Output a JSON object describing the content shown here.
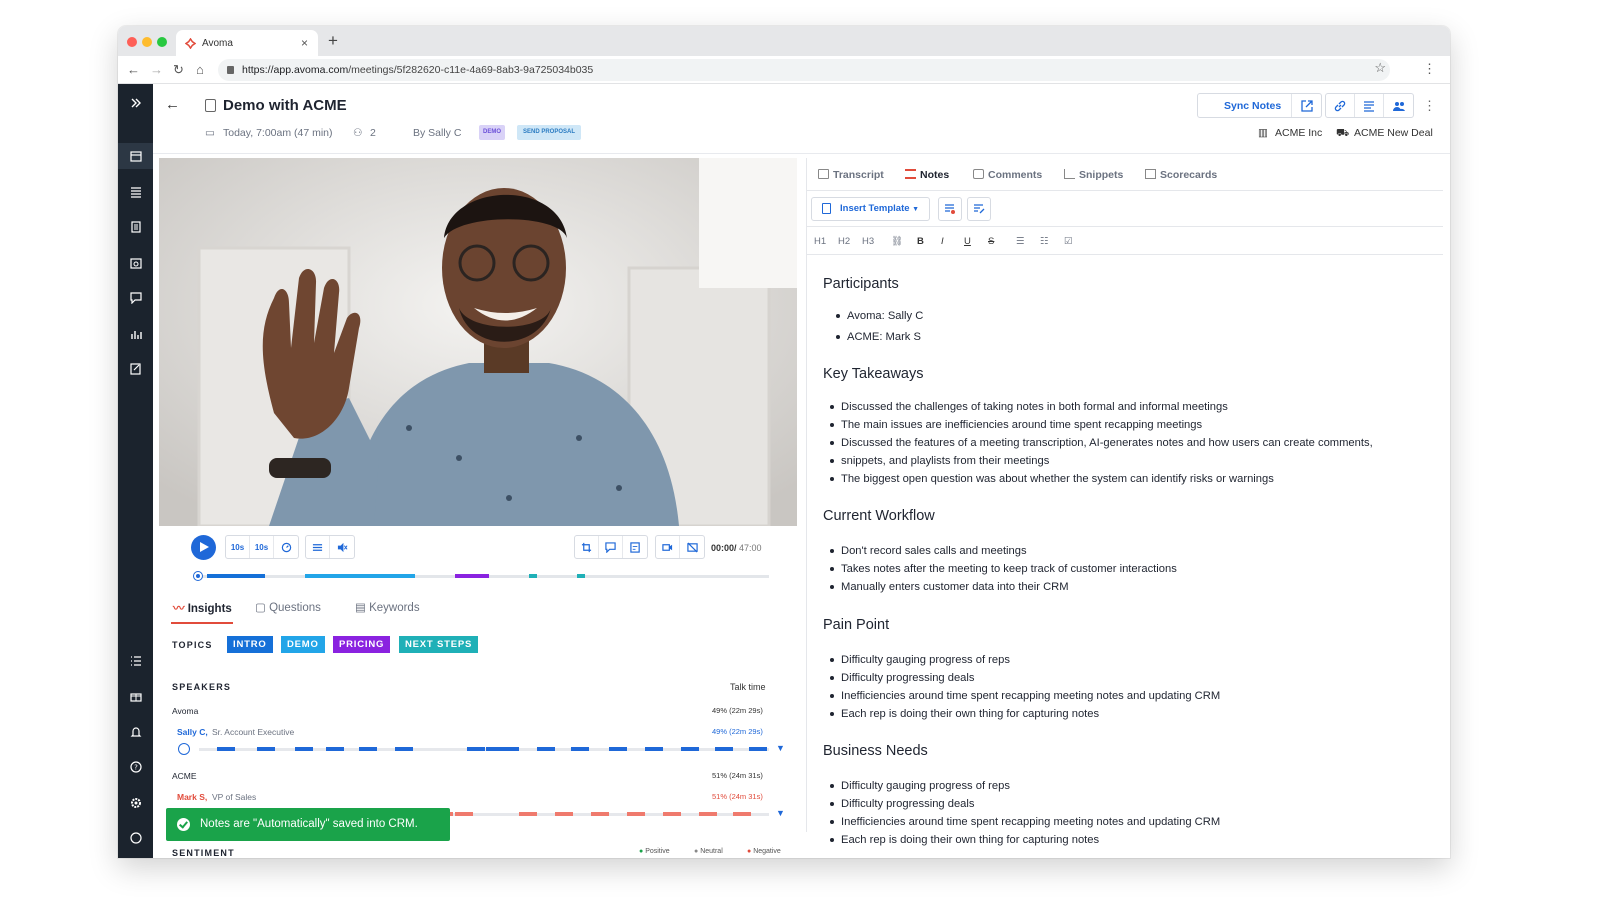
{
  "browser": {
    "tab_title": "Avoma",
    "url_prefix": "https://app.avoma.com",
    "url_path": "/meetings/5f282620-c11e-4a69-8ab3-9a725034b035"
  },
  "meeting": {
    "title": "Demo with ACME",
    "datetime": "Today, 7:00am (47 min)",
    "attendees": "2",
    "by": "By Sally C",
    "tag_demo": "DEMO",
    "tag_send": "SEND PROPOSAL",
    "sync_label": "Sync Notes",
    "crm_account": "ACME Inc",
    "crm_deal": "ACME New Deal"
  },
  "player": {
    "rewind": "10s",
    "forward": "10s",
    "time_current": "00:00/",
    "time_total": " 47:00",
    "progress": 0
  },
  "insights": {
    "tabs": [
      "Insights",
      "Questions",
      "Keywords"
    ],
    "topics_label": "TOPICS",
    "topics": [
      "INTRO",
      "DEMO",
      "PRICING",
      "NEXT STEPS"
    ],
    "speakers_label": "SPEAKERS",
    "talk_time_label": "Talk time",
    "groups": [
      {
        "org": "Avoma",
        "org_stat": "49%  (22m 29s)",
        "speaker": "Sally C,",
        "role": "Sr. Account Executive",
        "stat": "49%  (22m 29s)"
      },
      {
        "org": "ACME",
        "org_stat": "51%  (24m 31s)",
        "speaker": "Mark S,",
        "role": "VP of Sales",
        "stat": "51%  (24m 31s)"
      }
    ],
    "sentiment_label": "SENTIMENT",
    "legend": [
      "Positive",
      "Neutral",
      "Negative"
    ]
  },
  "toast": "Notes are \"Automatically\" saved into CRM.",
  "notes_tabs": [
    "Transcript",
    "Notes",
    "Comments",
    "Snippets",
    "Scorecards"
  ],
  "insert_template": "Insert Template",
  "format_bar": [
    "H1",
    "H2",
    "H3"
  ],
  "notes": {
    "participants_h": "Participants",
    "participants": [
      "Avoma: Sally C",
      "ACME: Mark S"
    ],
    "takeaways_h": "Key Takeaways",
    "takeaways": [
      "Discussed the challenges of taking notes in both formal and informal meetings",
      "The main issues are inefficiencies around time spent recapping meetings",
      "Discussed the features of a meeting transcription, AI-generates notes and how users can create comments,",
      "snippets, and playlists from their meetings",
      "The biggest open question was about whether the system can identify risks or warnings"
    ],
    "workflow_h": "Current Workflow",
    "workflow": [
      "Don't record sales calls and meetings",
      "Takes notes after the meeting to keep track of customer interactions",
      "Manually enters customer data into their CRM"
    ],
    "pain_h": "Pain Point",
    "pain": [
      "Difficulty gauging progress of reps",
      "Difficulty progressing deals",
      "Inefficiencies around time spent recapping meeting notes and updating CRM",
      "Each rep is doing their own thing for capturing notes"
    ],
    "needs_h": "Business Needs",
    "needs": [
      "Difficulty gauging progress of reps",
      "Difficulty progressing deals",
      "Inefficiencies around time spent recapping meeting notes and updating CRM",
      "Each rep is doing their own thing for capturing notes"
    ]
  },
  "colors": {
    "sidebar": "#1b232d",
    "accent_blue": "#1f68d8",
    "accent_red": "#e14b3b",
    "topic_intro": "#1570d8",
    "topic_demo": "#22a5e8",
    "topic_pricing": "#8a22e0",
    "topic_next": "#1fb0b7",
    "toast": "#1aa34a"
  }
}
